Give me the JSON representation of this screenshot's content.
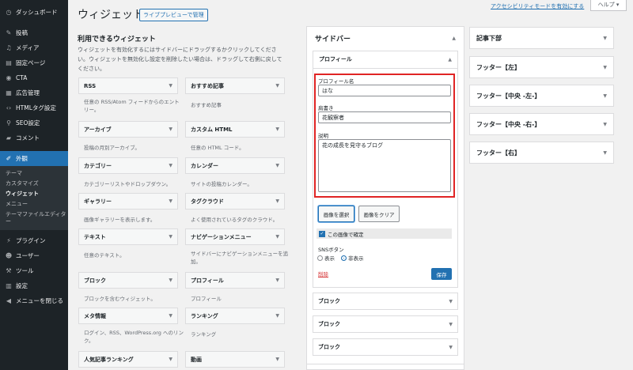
{
  "sidebar": {
    "items": [
      {
        "icon": "dashboard-icon",
        "glyph": "◷",
        "label": "ダッシュボード"
      },
      {
        "icon": "pin-icon",
        "glyph": "✎",
        "label": "投稿"
      },
      {
        "icon": "media-icon",
        "glyph": "♫",
        "label": "メディア"
      },
      {
        "icon": "page-icon",
        "glyph": "▤",
        "label": "固定ページ"
      },
      {
        "icon": "cta-icon",
        "glyph": "◉",
        "label": "CTA"
      },
      {
        "icon": "ad-icon",
        "glyph": "▦",
        "label": "広告管理"
      },
      {
        "icon": "code-icon",
        "glyph": "‹›",
        "label": "HTMLタグ設定"
      },
      {
        "icon": "seo-icon",
        "glyph": "⚲",
        "label": "SEO設定"
      },
      {
        "icon": "comment-icon",
        "glyph": "▰",
        "label": "コメント"
      },
      {
        "icon": "appearance-icon",
        "glyph": "✐",
        "label": "外観"
      },
      {
        "icon": "plugin-icon",
        "glyph": "⚡",
        "label": "プラグイン"
      },
      {
        "icon": "user-icon",
        "glyph": "☻",
        "label": "ユーザー"
      },
      {
        "icon": "tools-icon",
        "glyph": "⚒",
        "label": "ツール"
      },
      {
        "icon": "settings-icon",
        "glyph": "▥",
        "label": "設定"
      },
      {
        "icon": "collapse-icon",
        "glyph": "◀",
        "label": "メニューを閉じる"
      }
    ],
    "submenu": [
      "テーマ",
      "カスタマイズ",
      "ウィジェット",
      "メニュー",
      "テーマファイルエディター"
    ]
  },
  "header": {
    "title": "ウィジェット",
    "live_preview": "ライブプレビューで管理",
    "a11y_link": "アクセシビリティモードを有効にする",
    "help": "ヘルプ ▾"
  },
  "available": {
    "title": "利用できるウィジェット",
    "description": "ウィジェットを有効化するにはサイドバーにドラッグするかクリックしてください。ウィジェットを無効化し設定を削除したい場合は、ドラッグして右側に戻してください。",
    "widgets": [
      {
        "name": "RSS",
        "desc": "任意の RSS/Atom フィードからのエントリー。"
      },
      {
        "name": "おすすめ記事",
        "desc": "おすすめ記事"
      },
      {
        "name": "アーカイブ",
        "desc": "投稿の月別アーカイブ。"
      },
      {
        "name": "カスタム HTML",
        "desc": "任意の HTML コード。"
      },
      {
        "name": "カテゴリー",
        "desc": "カテゴリーリストやドロップダウン。"
      },
      {
        "name": "カレンダー",
        "desc": "サイトの投稿カレンダー。"
      },
      {
        "name": "ギャラリー",
        "desc": "画像ギャラリーを表示します。"
      },
      {
        "name": "タグクラウド",
        "desc": "よく使用されているタグのクラウド。"
      },
      {
        "name": "テキスト",
        "desc": "任意のテキスト。"
      },
      {
        "name": "ナビゲーションメニュー",
        "desc": "サイドバーにナビゲーションメニューを追加。"
      },
      {
        "name": "ブロック",
        "desc": "ブロックを含むウィジェット。"
      },
      {
        "name": "プロフィール",
        "desc": "プロフィール"
      },
      {
        "name": "メタ情報",
        "desc": "ログイン、RSS、WordPress.org へのリンク。"
      },
      {
        "name": "ランキング",
        "desc": "ランキング"
      },
      {
        "name": "人気記事ランキング",
        "desc": ""
      },
      {
        "name": "動画",
        "desc": ""
      }
    ]
  },
  "sidebar_area": {
    "title": "サイドバー",
    "profile": {
      "title": "プロフィール",
      "name_label": "プロフィール名",
      "name_value": "はな",
      "job_label": "肩書き",
      "job_value": "花観察者",
      "desc_label": "説明",
      "desc_value": "花の成長を見守るブログ",
      "select_image": "画像を選択",
      "clear_image": "画像をクリア",
      "confirm_image": "この画像で確定",
      "sns_label": "SNSボタン",
      "sns_show": "表示",
      "sns_hide": "非表示",
      "delete": "削除",
      "save": "保存"
    },
    "blocks": [
      "ブロック",
      "ブロック",
      "ブロック"
    ]
  },
  "right_areas": [
    "記事下部",
    "フッター【左】",
    "フッター【中央 -左-】",
    "フッター【中央 -右-】",
    "フッター【右】"
  ],
  "colors": {
    "accent": "#2271b1",
    "admin_bar": "#1d2327",
    "highlight": "#e02424"
  }
}
